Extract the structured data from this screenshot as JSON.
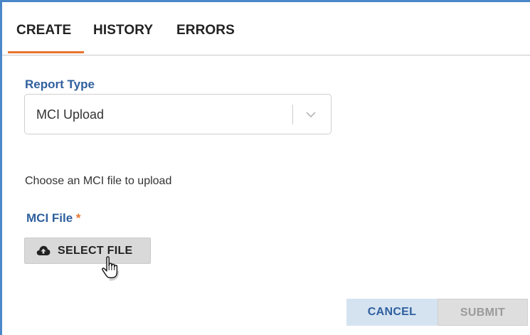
{
  "tabs": [
    {
      "label": "CREATE",
      "active": true
    },
    {
      "label": "HISTORY",
      "active": false
    },
    {
      "label": "ERRORS",
      "active": false
    }
  ],
  "form": {
    "report_type_label": "Report Type",
    "report_type_value": "MCI Upload",
    "hint": "Choose an MCI file to upload",
    "file_label": "MCI File",
    "required_marker": "*",
    "select_file_label": "SELECT FILE",
    "select_file_icon": "cloud-upload-icon"
  },
  "actions": {
    "cancel_label": "CANCEL",
    "submit_label": "SUBMIT",
    "submit_disabled": true
  },
  "colors": {
    "accent_orange": "#e8742c",
    "label_blue": "#2f5f9e",
    "frame_blue": "#4a86c8"
  }
}
